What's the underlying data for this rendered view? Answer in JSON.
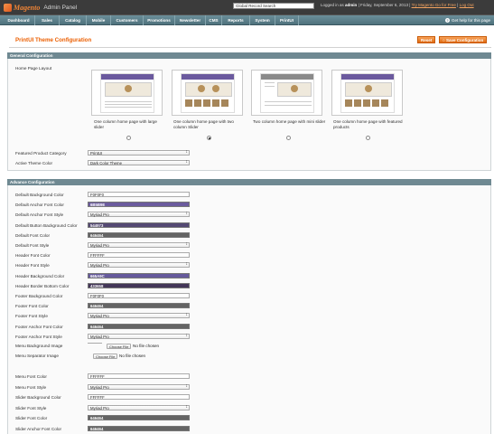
{
  "header": {
    "brand": "Magento",
    "brand_sub": "Admin Panel",
    "search_value": "Global Record Search",
    "user_prefix": "Logged in as",
    "username": "admin",
    "date": "Friday, September 6, 2013",
    "try_link": "Try Magento Go for Free",
    "logout": "Log Out"
  },
  "nav": {
    "items": [
      "Dashboard",
      "Sales",
      "Catalog",
      "Mobile",
      "Customers",
      "Promotions",
      "Newsletter",
      "CMS",
      "Reports",
      "System",
      "PrintUI"
    ],
    "help": "Get help for this page",
    "help_icon": "help-circle-icon"
  },
  "page": {
    "title": "PrintUI Theme Configuration",
    "reset_label": "Reset",
    "save_label": "Save Configuration"
  },
  "general": {
    "heading": "General Configuration",
    "home_layout_label": "Home Page Layout",
    "layouts": [
      {
        "caption": "One column home page with large slider",
        "selected": false
      },
      {
        "caption": "One column home page with two column Slider",
        "selected": true
      },
      {
        "caption": "Two column home page with mini slider",
        "selected": false
      },
      {
        "caption": "One column home page with featured products",
        "selected": false
      }
    ],
    "featured_label": "Featured Product Category",
    "featured_value": "PrintUI",
    "theme_color_label": "Active Theme Color",
    "theme_color_value": "Dark Color Theme"
  },
  "advance": {
    "heading": "Advance Configuration",
    "rows": [
      {
        "label": "Default Background Color",
        "kind": "input",
        "value": "F0F0F0",
        "color": "#ffffff"
      },
      {
        "label": "Default Anchor Font Color",
        "kind": "color",
        "value": "6B5B9E",
        "color": "#6b5b9e"
      },
      {
        "label": "Default Anchor Font Style",
        "kind": "select",
        "value": "Myriad Pro"
      },
      {
        "label": "Default Button Background Color",
        "kind": "color",
        "value": "544973",
        "color": "#544973"
      },
      {
        "label": "Default Font Color",
        "kind": "color",
        "value": "646464",
        "color": "#646464"
      },
      {
        "label": "Default Font Style",
        "kind": "select",
        "value": "Myriad Pro"
      },
      {
        "label": "Header Font Color",
        "kind": "input",
        "value": "FFFFFF",
        "color": "#ffffff"
      },
      {
        "label": "Header Font Style",
        "kind": "select",
        "value": "Myriad Pro"
      },
      {
        "label": "Header Background Color",
        "kind": "color",
        "value": "665A9C",
        "color": "#665a9c"
      },
      {
        "label": "Header Border Bottom Color",
        "kind": "color",
        "value": "433658",
        "color": "#433658"
      },
      {
        "label": "Footer Background Color",
        "kind": "input",
        "value": "F0F0F0",
        "color": "#ffffff"
      },
      {
        "label": "Footer Font Color",
        "kind": "color",
        "value": "646464",
        "color": "#646464"
      },
      {
        "label": "Footer Font Style",
        "kind": "select",
        "value": "Myriad Pro"
      },
      {
        "label": "Footer Anchor Font Color",
        "kind": "color",
        "value": "646464",
        "color": "#646464"
      },
      {
        "label": "Footer Anchor Font Style",
        "kind": "select",
        "value": "Myriad Pro"
      }
    ],
    "menu_bg_label": "Menu Background Image",
    "menu_sep_label": "Menu Separator Image",
    "choose_file": "Choose File",
    "no_file": "No file chosen",
    "rows2": [
      {
        "label": "Menu Font Color",
        "kind": "input",
        "value": "FFFFFF",
        "color": "#ffffff"
      },
      {
        "label": "Menu Font Style",
        "kind": "select",
        "value": "Myriad Pro"
      },
      {
        "label": "Slider Background Color",
        "kind": "input",
        "value": "FFFFFF",
        "color": "#ffffff"
      },
      {
        "label": "Slider Font Style",
        "kind": "select",
        "value": "Myriad Pro"
      },
      {
        "label": "Slider Font Color",
        "kind": "color",
        "value": "646464",
        "color": "#646464"
      },
      {
        "label": "Slider Anchor Font Color",
        "kind": "color",
        "value": "646464",
        "color": "#646464"
      }
    ]
  },
  "colors": {
    "accent": "#eb5e00",
    "nav": "#5e7f89",
    "section": "#6f8992"
  }
}
